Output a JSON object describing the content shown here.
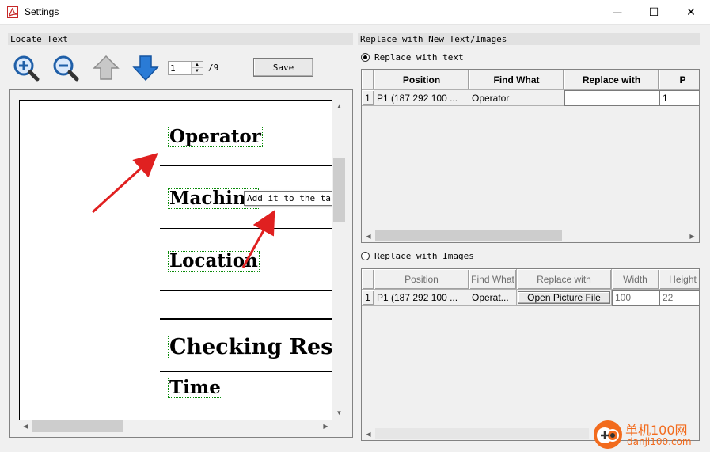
{
  "window": {
    "title": "Settings",
    "minimize_glyph": "—",
    "maximize_glyph": "☐",
    "close_glyph": "✕"
  },
  "left": {
    "header": "Locate Text",
    "toolbar": {
      "zoom_in_icon": "zoom-in-icon",
      "zoom_out_icon": "zoom-out-icon",
      "prev_page_icon": "arrow-up-icon",
      "next_page_icon": "arrow-down-icon",
      "page_value": "1",
      "page_total": "/9",
      "save_label": "Save"
    },
    "document": {
      "fields": [
        "Operator",
        "Machine",
        "Location",
        "Checking Result",
        "Time"
      ],
      "tooltip": "Add it to the table"
    }
  },
  "right": {
    "header": "Replace with New Text/Images",
    "text_option": {
      "label": "Replace with text",
      "selected": true,
      "columns": [
        "Position",
        "Find What",
        "Replace with",
        "P"
      ],
      "rows": [
        {
          "num": "1",
          "position": "P1 (187 292 100 ...",
          "find": "Operator",
          "replace": "",
          "page": "1"
        }
      ]
    },
    "image_option": {
      "label": "Replace with Images",
      "selected": false,
      "columns": [
        "Position",
        "Find What",
        "Replace with",
        "Width",
        "Height"
      ],
      "rows": [
        {
          "num": "1",
          "position": "P1 (187 292 100 ...",
          "find": "Operat...",
          "button": "Open Picture File",
          "width": "100",
          "height": "22"
        }
      ]
    }
  },
  "watermark": {
    "text": "单机100网",
    "url": "danji100.com"
  },
  "colors": {
    "arrow": "#e02020",
    "field_border": "#0a8a0a",
    "icon_blue": "#2a7bd6",
    "watermark_orange": "#f26b1d"
  }
}
